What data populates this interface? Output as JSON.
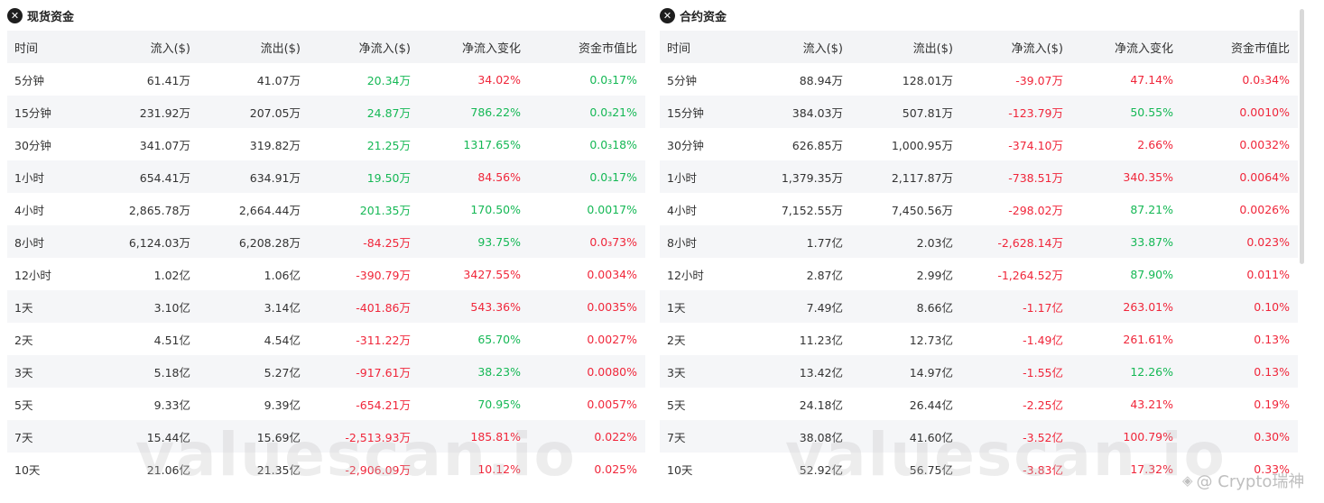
{
  "columns": [
    "时间",
    "流入($)",
    "流出($)",
    "净流入($)",
    "净流入变化",
    "资金市值比"
  ],
  "spot": {
    "title": "现货资金",
    "rows": [
      {
        "time": "5分钟",
        "inflow": "61.41万",
        "outflow": "41.07万",
        "net": "20.34万",
        "net_color": "green",
        "change": "34.02%",
        "change_color": "red",
        "ratio": "0.0₃17%",
        "ratio_color": "green"
      },
      {
        "time": "15分钟",
        "inflow": "231.92万",
        "outflow": "207.05万",
        "net": "24.87万",
        "net_color": "green",
        "change": "786.22%",
        "change_color": "green",
        "ratio": "0.0₃21%",
        "ratio_color": "green"
      },
      {
        "time": "30分钟",
        "inflow": "341.07万",
        "outflow": "319.82万",
        "net": "21.25万",
        "net_color": "green",
        "change": "1317.65%",
        "change_color": "green",
        "ratio": "0.0₃18%",
        "ratio_color": "green"
      },
      {
        "time": "1小时",
        "inflow": "654.41万",
        "outflow": "634.91万",
        "net": "19.50万",
        "net_color": "green",
        "change": "84.56%",
        "change_color": "red",
        "ratio": "0.0₃17%",
        "ratio_color": "green"
      },
      {
        "time": "4小时",
        "inflow": "2,865.78万",
        "outflow": "2,664.44万",
        "net": "201.35万",
        "net_color": "green",
        "change": "170.50%",
        "change_color": "green",
        "ratio": "0.0017%",
        "ratio_color": "green"
      },
      {
        "time": "8小时",
        "inflow": "6,124.03万",
        "outflow": "6,208.28万",
        "net": "-84.25万",
        "net_color": "red",
        "change": "93.75%",
        "change_color": "green",
        "ratio": "0.0₃73%",
        "ratio_color": "red"
      },
      {
        "time": "12小时",
        "inflow": "1.02亿",
        "outflow": "1.06亿",
        "net": "-390.79万",
        "net_color": "red",
        "change": "3427.55%",
        "change_color": "red",
        "ratio": "0.0034%",
        "ratio_color": "red"
      },
      {
        "time": "1天",
        "inflow": "3.10亿",
        "outflow": "3.14亿",
        "net": "-401.86万",
        "net_color": "red",
        "change": "543.36%",
        "change_color": "red",
        "ratio": "0.0035%",
        "ratio_color": "red"
      },
      {
        "time": "2天",
        "inflow": "4.51亿",
        "outflow": "4.54亿",
        "net": "-311.22万",
        "net_color": "red",
        "change": "65.70%",
        "change_color": "green",
        "ratio": "0.0027%",
        "ratio_color": "red"
      },
      {
        "time": "3天",
        "inflow": "5.18亿",
        "outflow": "5.27亿",
        "net": "-917.61万",
        "net_color": "red",
        "change": "38.23%",
        "change_color": "green",
        "ratio": "0.0080%",
        "ratio_color": "red"
      },
      {
        "time": "5天",
        "inflow": "9.33亿",
        "outflow": "9.39亿",
        "net": "-654.21万",
        "net_color": "red",
        "change": "70.95%",
        "change_color": "green",
        "ratio": "0.0057%",
        "ratio_color": "red"
      },
      {
        "time": "7天",
        "inflow": "15.44亿",
        "outflow": "15.69亿",
        "net": "-2,513.93万",
        "net_color": "red",
        "change": "185.81%",
        "change_color": "red",
        "ratio": "0.022%",
        "ratio_color": "red"
      },
      {
        "time": "10天",
        "inflow": "21.06亿",
        "outflow": "21.35亿",
        "net": "-2,906.09万",
        "net_color": "red",
        "change": "10.12%",
        "change_color": "red",
        "ratio": "0.025%",
        "ratio_color": "red"
      }
    ]
  },
  "contract": {
    "title": "合约资金",
    "rows": [
      {
        "time": "5分钟",
        "inflow": "88.94万",
        "outflow": "128.01万",
        "net": "-39.07万",
        "net_color": "red",
        "change": "47.14%",
        "change_color": "red",
        "ratio": "0.0₃34%",
        "ratio_color": "red"
      },
      {
        "time": "15分钟",
        "inflow": "384.03万",
        "outflow": "507.81万",
        "net": "-123.79万",
        "net_color": "red",
        "change": "50.55%",
        "change_color": "green",
        "ratio": "0.0010%",
        "ratio_color": "red"
      },
      {
        "time": "30分钟",
        "inflow": "626.85万",
        "outflow": "1,000.95万",
        "net": "-374.10万",
        "net_color": "red",
        "change": "2.66%",
        "change_color": "red",
        "ratio": "0.0032%",
        "ratio_color": "red"
      },
      {
        "time": "1小时",
        "inflow": "1,379.35万",
        "outflow": "2,117.87万",
        "net": "-738.51万",
        "net_color": "red",
        "change": "340.35%",
        "change_color": "red",
        "ratio": "0.0064%",
        "ratio_color": "red"
      },
      {
        "time": "4小时",
        "inflow": "7,152.55万",
        "outflow": "7,450.56万",
        "net": "-298.02万",
        "net_color": "red",
        "change": "87.21%",
        "change_color": "green",
        "ratio": "0.0026%",
        "ratio_color": "red"
      },
      {
        "time": "8小时",
        "inflow": "1.77亿",
        "outflow": "2.03亿",
        "net": "-2,628.14万",
        "net_color": "red",
        "change": "33.87%",
        "change_color": "green",
        "ratio": "0.023%",
        "ratio_color": "red"
      },
      {
        "time": "12小时",
        "inflow": "2.87亿",
        "outflow": "2.99亿",
        "net": "-1,264.52万",
        "net_color": "red",
        "change": "87.90%",
        "change_color": "green",
        "ratio": "0.011%",
        "ratio_color": "red"
      },
      {
        "time": "1天",
        "inflow": "7.49亿",
        "outflow": "8.66亿",
        "net": "-1.17亿",
        "net_color": "red",
        "change": "263.01%",
        "change_color": "red",
        "ratio": "0.10%",
        "ratio_color": "red"
      },
      {
        "time": "2天",
        "inflow": "11.23亿",
        "outflow": "12.73亿",
        "net": "-1.49亿",
        "net_color": "red",
        "change": "261.61%",
        "change_color": "red",
        "ratio": "0.13%",
        "ratio_color": "red"
      },
      {
        "time": "3天",
        "inflow": "13.42亿",
        "outflow": "14.97亿",
        "net": "-1.55亿",
        "net_color": "red",
        "change": "12.26%",
        "change_color": "green",
        "ratio": "0.13%",
        "ratio_color": "red"
      },
      {
        "time": "5天",
        "inflow": "24.18亿",
        "outflow": "26.44亿",
        "net": "-2.25亿",
        "net_color": "red",
        "change": "43.21%",
        "change_color": "red",
        "ratio": "0.19%",
        "ratio_color": "red"
      },
      {
        "time": "7天",
        "inflow": "38.08亿",
        "outflow": "41.60亿",
        "net": "-3.52亿",
        "net_color": "red",
        "change": "100.79%",
        "change_color": "red",
        "ratio": "0.30%",
        "ratio_color": "red"
      },
      {
        "time": "10天",
        "inflow": "52.92亿",
        "outflow": "56.75亿",
        "net": "-3.83亿",
        "net_color": "red",
        "change": "17.32%",
        "change_color": "red",
        "ratio": "0.33%",
        "ratio_color": "red"
      }
    ]
  },
  "watermark": "valuescan.io",
  "credit": "@ Crypto瑞神",
  "colors": {
    "green": "#15b855",
    "red": "#f0263a",
    "header_bg": "#f3f4f6"
  }
}
